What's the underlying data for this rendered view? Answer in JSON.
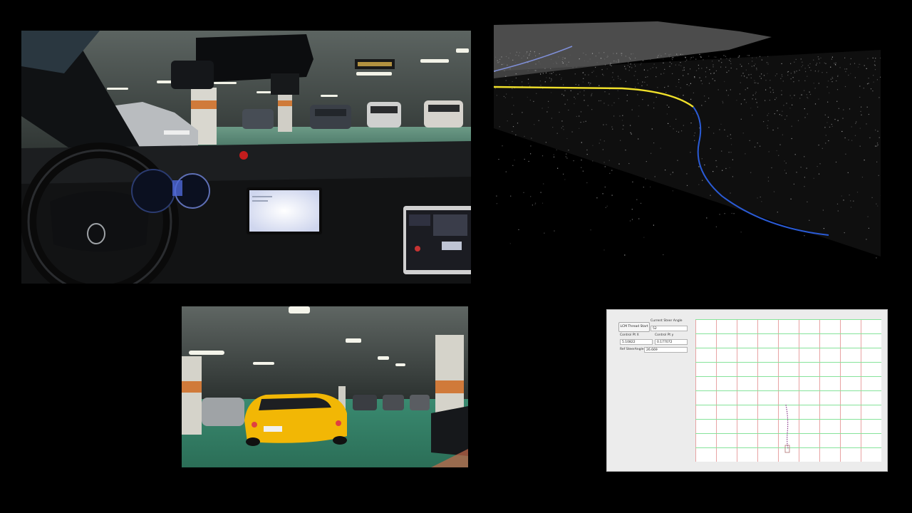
{
  "control_app": {
    "thread_button": "LCM Thread Start",
    "current_steer_angle": {
      "label": "Current Steer Angle",
      "value": "52"
    },
    "control_pt_x": {
      "label": "Control Pt X",
      "value": "5.10822"
    },
    "control_pt_y": {
      "label": "Control Pt y",
      "value": "0.177072"
    },
    "ref_steer_angle": {
      "label": "Ref SteerAngle",
      "value": "26.669"
    }
  },
  "colors": {
    "grid_green": "#86e39a",
    "grid_red": "#e8a3a3",
    "trajectory_path": "#8a3a8a",
    "lidar_path_yellow": "#f0e02a",
    "lidar_path_blue": "#2a5bd6",
    "taxi_yellow": "#f2b705",
    "floor_green": "#2e8f6e"
  }
}
